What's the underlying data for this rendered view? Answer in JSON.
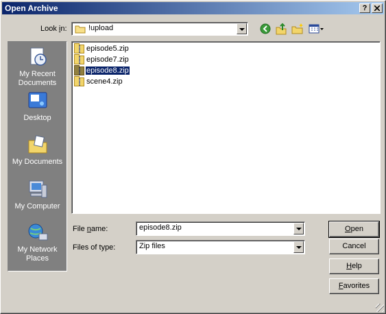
{
  "window": {
    "title": "Open Archive",
    "help_btn": "?",
    "close_btn": "✕"
  },
  "lookin": {
    "label_pre": "Look ",
    "label_u": "i",
    "label_post": "n:",
    "value": "!upload"
  },
  "places": [
    {
      "label": "My Recent Documents",
      "icon": "recent-documents-icon"
    },
    {
      "label": "Desktop",
      "icon": "desktop-icon"
    },
    {
      "label": "My Documents",
      "icon": "my-documents-icon"
    },
    {
      "label": "My Computer",
      "icon": "my-computer-icon"
    },
    {
      "label": "My Network Places",
      "icon": "network-places-icon"
    }
  ],
  "files": [
    {
      "name": "episode5.zip",
      "selected": false
    },
    {
      "name": "episode7.zip",
      "selected": false
    },
    {
      "name": "episode8.zip",
      "selected": true
    },
    {
      "name": "scene4.zip",
      "selected": false
    }
  ],
  "filename": {
    "label_pre": "File ",
    "label_u": "n",
    "label_post": "ame:",
    "value": "episode8.zip"
  },
  "filetype": {
    "label": "Files of type:",
    "value": "Zip files"
  },
  "buttons": {
    "open_u": "O",
    "open_rest": "pen",
    "cancel": "Cancel",
    "help_u": "H",
    "help_rest": "elp",
    "fav_u": "F",
    "fav_rest": "avorites"
  }
}
